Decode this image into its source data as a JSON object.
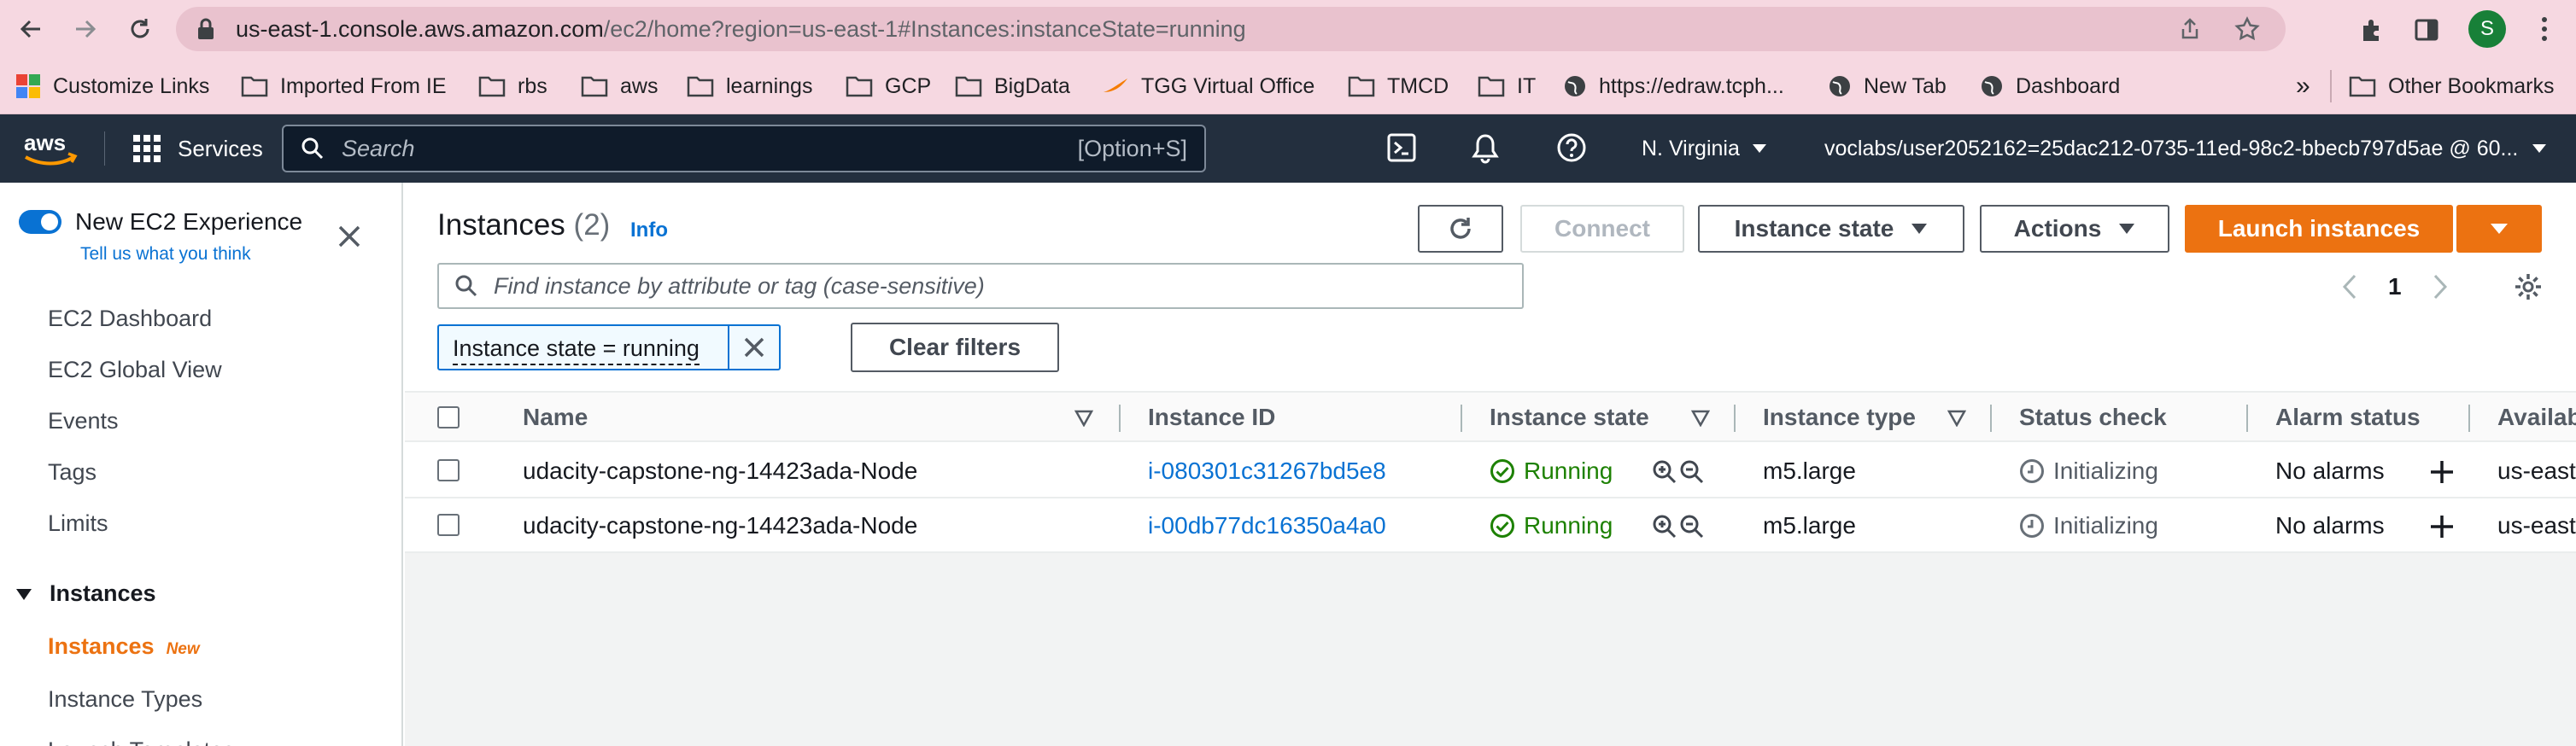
{
  "browser": {
    "url_host": "us-east-1.console.aws.amazon.com",
    "url_path": "/ec2/home?region=us-east-1#Instances:instanceState=running",
    "profile_initial": "S",
    "bookmarks": [
      "Customize Links",
      "Imported From IE",
      "rbs",
      "aws",
      "learnings",
      "GCP",
      "BigData",
      "TGG Virtual Office",
      "TMCD",
      "IT",
      "https://edraw.tcph...",
      "New Tab",
      "Dashboard"
    ],
    "more_label": "»",
    "other_bookmarks": "Other Bookmarks"
  },
  "aws_nav": {
    "services_label": "Services",
    "search_placeholder": "Search",
    "search_shortcut": "[Option+S]",
    "region": "N. Virginia",
    "account": "voclabs/user2052162=25dac212-0735-11ed-98c2-bbecb797d5ae @ 60..."
  },
  "sidebar": {
    "experience_title": "New EC2 Experience",
    "experience_subtitle": "Tell us what you think",
    "items": [
      "EC2 Dashboard",
      "EC2 Global View",
      "Events",
      "Tags",
      "Limits"
    ],
    "section_title": "Instances",
    "active_item": "Instances",
    "active_badge": "New",
    "after_items": [
      "Instance Types",
      "Launch Templates"
    ]
  },
  "page": {
    "title": "Instances",
    "count": "(2)",
    "info_label": "Info",
    "connect_label": "Connect",
    "instance_state_label": "Instance state",
    "actions_label": "Actions",
    "launch_label": "Launch instances",
    "filter_placeholder": "Find instance by attribute or tag (case-sensitive)",
    "page_number": "1",
    "filter_token": "Instance state = running",
    "clear_filters_label": "Clear filters"
  },
  "table": {
    "columns": [
      "Name",
      "Instance ID",
      "Instance state",
      "Instance type",
      "Status check",
      "Alarm status",
      "Availab"
    ],
    "rows": [
      {
        "name": "udacity-capstone-ng-14423ada-Node",
        "id": "i-080301c31267bd5e8",
        "state": "Running",
        "type": "m5.large",
        "status": "Initializing",
        "alarm": "No alarms",
        "az": "us-east"
      },
      {
        "name": "udacity-capstone-ng-14423ada-Node",
        "id": "i-00db77dc16350a4a0",
        "state": "Running",
        "type": "m5.large",
        "status": "Initializing",
        "alarm": "No alarms",
        "az": "us-east"
      }
    ]
  },
  "colors": {
    "aws_orange": "#ec7211",
    "link_blue": "#0972d3",
    "running_green": "#1d8102",
    "nav_bg": "#232f3e"
  }
}
